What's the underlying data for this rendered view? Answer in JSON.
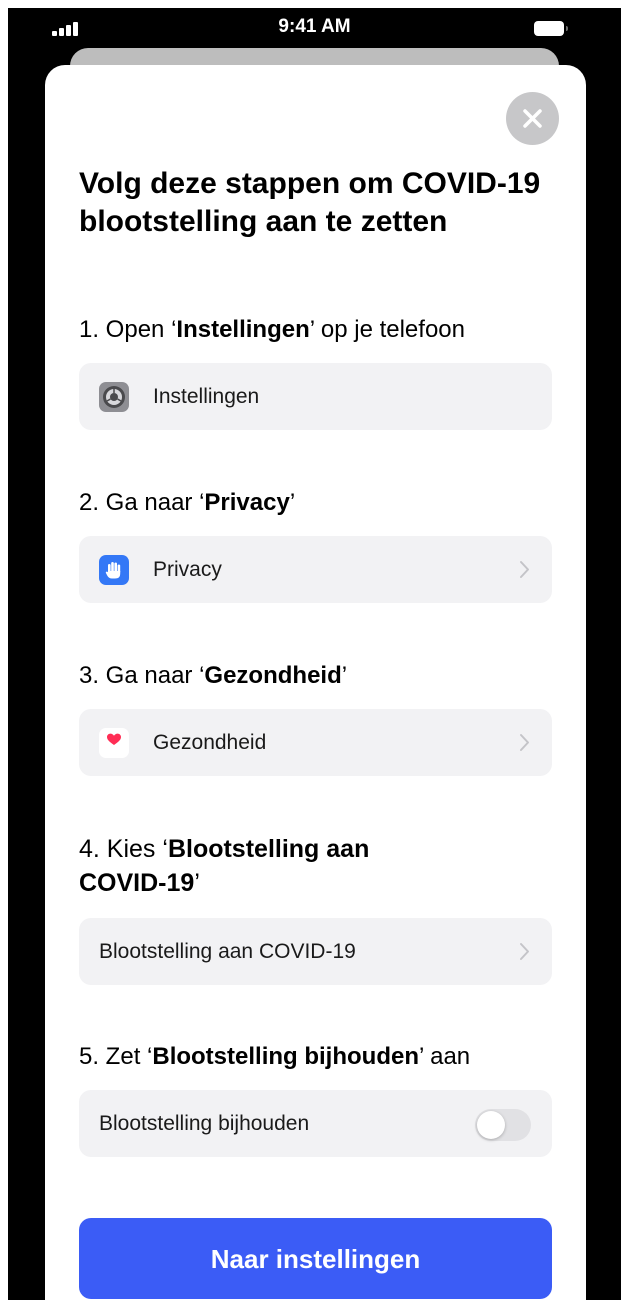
{
  "status_bar": {
    "time": "9:41 AM"
  },
  "sheet": {
    "title": "Volg deze stappen om COVID-19 blootstelling aan te zetten",
    "close_icon": "close-icon"
  },
  "steps": [
    {
      "prefix": "1. Open ‘",
      "bold": "Instellingen",
      "suffix": "’ op je telefoon",
      "row_label": "Instellingen",
      "icon": "settings-gear-icon",
      "has_chevron": false
    },
    {
      "prefix": "2. Ga naar ‘",
      "bold": "Privacy",
      "suffix": "’",
      "row_label": "Privacy",
      "icon": "privacy-hand-icon",
      "has_chevron": true
    },
    {
      "prefix": "3. Ga naar ‘",
      "bold": "Gezondheid",
      "suffix": "’",
      "row_label": "Gezondheid",
      "icon": "health-heart-icon",
      "has_chevron": true
    },
    {
      "prefix": "4. Kies ‘",
      "bold": "Blootstelling aan COVID-19",
      "suffix": "’",
      "row_label": "Blootstelling aan COVID-19",
      "has_chevron": true
    },
    {
      "prefix": "5. Zet ‘",
      "bold": "Blootstelling bijhouden",
      "suffix": "’ aan",
      "row_label": "Blootstelling bijhouden",
      "toggle_on": false
    }
  ],
  "cta": {
    "label": "Naar instellingen"
  },
  "colors": {
    "accent": "#3b5cf6",
    "privacy_icon": "#3478f6",
    "health_heart": "#ff2d55",
    "row_background": "#f2f2f4"
  }
}
